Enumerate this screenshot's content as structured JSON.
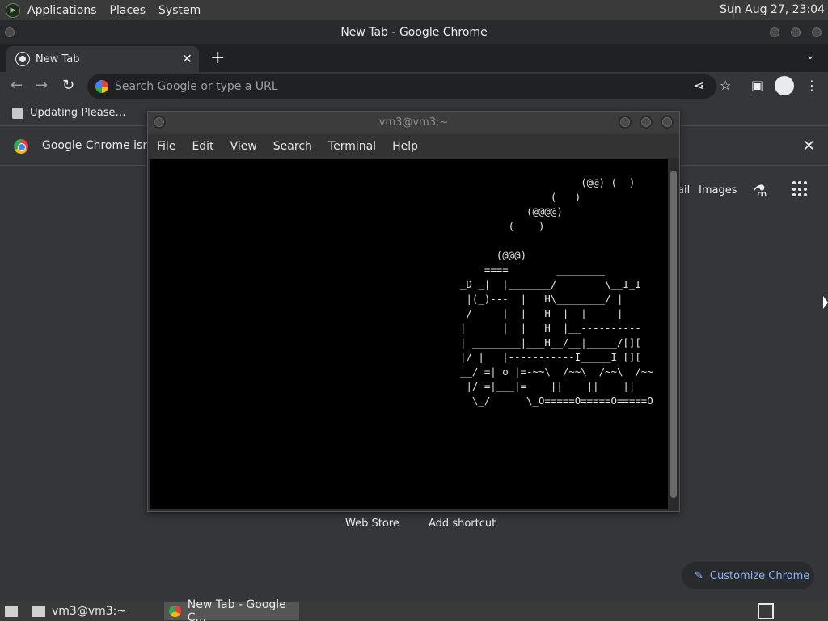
{
  "top_panel": {
    "menus": [
      "Applications",
      "Places",
      "System"
    ],
    "clock": "Sun Aug 27, 23:04"
  },
  "chrome": {
    "window_title": "New Tab - Google Chrome",
    "tab_title": "New Tab",
    "omnibox_placeholder": "Search Google or type a URL",
    "bookmark": "Updating Please…",
    "infobar_message": "Google Chrome isn't",
    "ntp": {
      "gmail_fragment": "ail",
      "images": "Images",
      "shortcuts": [
        "Web Store",
        "Add shortcut"
      ],
      "customize": "Customize Chrome"
    }
  },
  "terminal": {
    "title": "vm3@vm3:~",
    "menus": [
      "File",
      "Edit",
      "View",
      "Search",
      "Terminal",
      "Help"
    ],
    "screen": "                    (@@) (  )\n               (   )\n           (@@@@)\n        (    )\n\n      (@@@)\n    ====        ________\n_D _|  |_______/        \\__I_I\n |(_)---  |   H\\________/ |\n /     |  |   H  |  |     |\n|      |  |   H  |__----------\n| ________|___H__/__|_____/[][\n|/ |   |-----------I_____I [][\n__/ =| o |=-~~\\  /~~\\  /~~\\  /~~\n |/-=|___|=    ||    ||    ||\n  \\_/      \\_O=====O=====O=====O"
  },
  "bottom_panel": {
    "tasks": [
      "vm3@vm3:~",
      "New Tab - Google C..."
    ]
  }
}
